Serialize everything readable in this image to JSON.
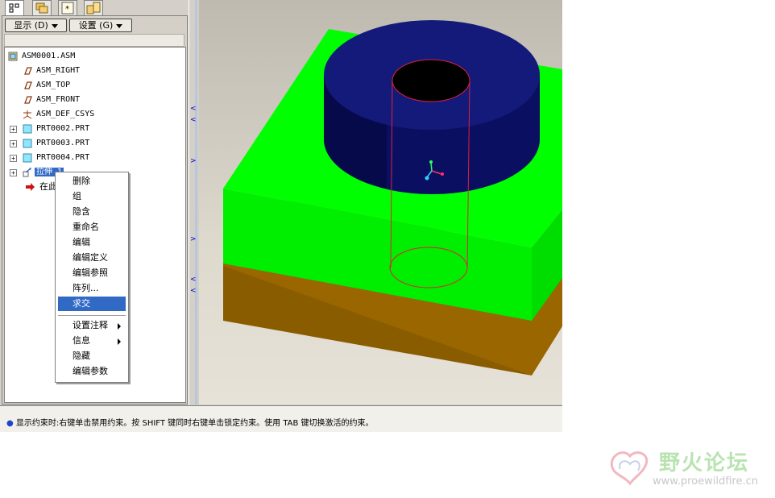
{
  "toolbar": {
    "show_menu": "显示 (D)",
    "settings_menu": "设置 (G)"
  },
  "tree": {
    "root": "ASM0001.ASM",
    "items": [
      {
        "label": "ASM_RIGHT",
        "icon": "datum-plane-icon"
      },
      {
        "label": "ASM_TOP",
        "icon": "datum-plane-icon"
      },
      {
        "label": "ASM_FRONT",
        "icon": "datum-plane-icon"
      },
      {
        "label": "ASM_DEF_CSYS",
        "icon": "csys-icon"
      },
      {
        "label": "PRT0002.PRT",
        "icon": "part-icon"
      },
      {
        "label": "PRT0003.PRT",
        "icon": "part-icon"
      },
      {
        "label": "PRT0004.PRT",
        "icon": "part-icon"
      },
      {
        "label": "拉伸 1",
        "icon": "extrude-icon"
      },
      {
        "label": "在此",
        "icon": "insert-here-arrow-icon"
      }
    ]
  },
  "context_menu": {
    "items": [
      "删除",
      "组",
      "隐含",
      "重命名",
      "编辑",
      "编辑定义",
      "编辑参照",
      "阵列...",
      "求交"
    ],
    "items2": [
      "设置注释",
      "信息",
      "隐藏",
      "编辑参数"
    ],
    "highlighted": "求交"
  },
  "status": {
    "line1": "显示约束时:右键单击禁用约束。按 SHIFT 键同时右键单击锁定约束。使用 TAB 键切换激活的约束。"
  },
  "watermark": {
    "name": "野火论坛",
    "url": "www.proewildfire.cn"
  },
  "colors": {
    "selection": "#316ac5",
    "cylinder": "#0b1065",
    "green_block": "#00ff00",
    "brown_block": "#996600",
    "hole_outline": "#e0203a"
  }
}
